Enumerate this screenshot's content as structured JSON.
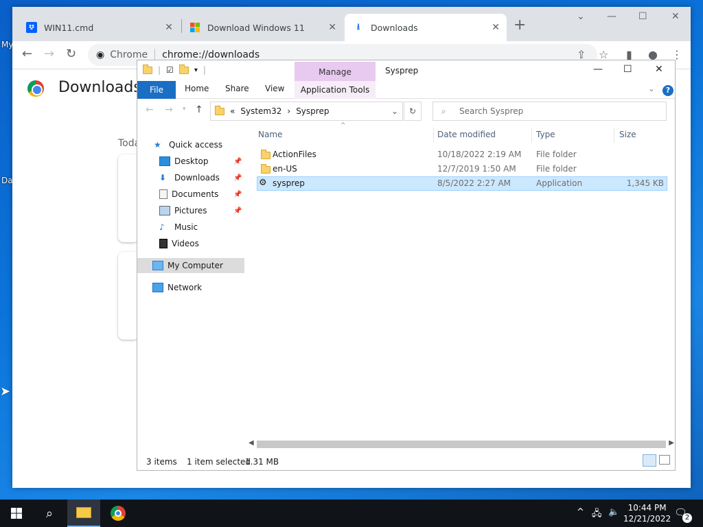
{
  "desktop": {
    "label_my": "My",
    "label_da": "Da"
  },
  "chrome": {
    "tabs": [
      {
        "label": "WIN11.cmd",
        "icon": "dropbox-icon"
      },
      {
        "label": "Download Windows 11",
        "icon": "windows-logo-icon"
      },
      {
        "label": "Downloads",
        "icon": "download-icon"
      }
    ],
    "omnibox": {
      "site_chip": "Chrome",
      "url": "chrome://downloads"
    },
    "page": {
      "title": "Downloads",
      "section": "Toda"
    }
  },
  "explorer": {
    "title": "Sysprep",
    "context_tab": "Manage",
    "ribbon_tabs": [
      "File",
      "Home",
      "Share",
      "View"
    ],
    "context_ribbon": "Application Tools",
    "breadcrumb": {
      "prefix": "«",
      "parts": [
        "System32",
        "Sysprep"
      ]
    },
    "search_placeholder": "Search Sysprep",
    "nav": {
      "quick_access": "Quick access",
      "items": [
        "Desktop",
        "Downloads",
        "Documents",
        "Pictures",
        "Music",
        "Videos"
      ],
      "my_computer": "My Computer",
      "network": "Network"
    },
    "columns": [
      "Name",
      "Date modified",
      "Type",
      "Size"
    ],
    "files": [
      {
        "name": "ActionFiles",
        "date": "10/18/2022 2:19 AM",
        "type": "File folder",
        "size": ""
      },
      {
        "name": "en-US",
        "date": "12/7/2019 1:50 AM",
        "type": "File folder",
        "size": ""
      },
      {
        "name": "sysprep",
        "date": "8/5/2022 2:27 AM",
        "type": "Application",
        "size": "1,345 KB"
      }
    ],
    "status": {
      "count": "3 items",
      "selected": "1 item selected",
      "size": "1.31 MB"
    }
  },
  "taskbar": {
    "time": "10:44 PM",
    "date": "12/21/2022",
    "notifications": "2"
  }
}
